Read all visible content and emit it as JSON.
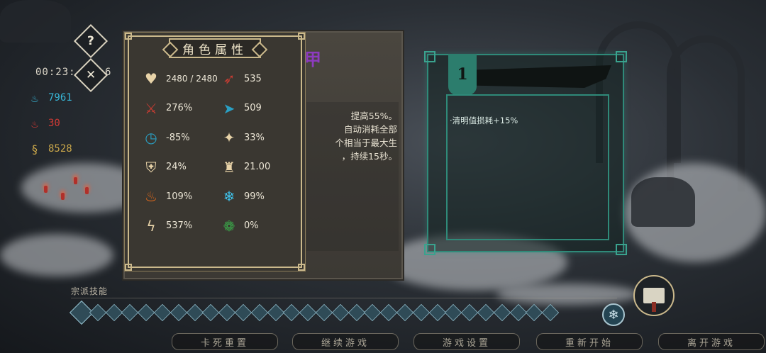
{
  "hud": {
    "help_label": "?",
    "close_label": "✕",
    "timer": "00:23:",
    "timer_tail": "6",
    "resources": [
      {
        "icon": "blue-flame-icon",
        "glyph": "♨",
        "value": "7961",
        "color": "#38b7d8"
      },
      {
        "icon": "red-flame-icon",
        "glyph": "♨",
        "value": "30",
        "color": "#d03a35"
      },
      {
        "icon": "gold-coil-icon",
        "glyph": "§",
        "value": "8528",
        "color": "#c9a64a"
      }
    ]
  },
  "attributes": {
    "title": "角色属性",
    "stats": [
      {
        "icon": "heart-icon",
        "glyph": "♥",
        "color": "#e8d3a8",
        "value": "2480 / 2480"
      },
      {
        "icon": "attack-icon",
        "glyph": "➶",
        "color": "#c83c32",
        "value": "535"
      },
      {
        "icon": "crit-rate-icon",
        "glyph": "⚔",
        "color": "#c83c32",
        "value": "276%"
      },
      {
        "icon": "speed-icon",
        "glyph": "➤",
        "color": "#2aa0c4",
        "value": "509"
      },
      {
        "icon": "cooldown-icon",
        "glyph": "◷",
        "color": "#2aa0c4",
        "value": "-85%"
      },
      {
        "icon": "dodge-icon",
        "glyph": "✦",
        "color": "#e8d3a8",
        "value": "33%"
      },
      {
        "icon": "shield-icon",
        "glyph": "⛨",
        "color": "#e8d3a8",
        "value": "24%"
      },
      {
        "icon": "armor-icon",
        "glyph": "♜",
        "color": "#e8d3a8",
        "value": "21.00"
      },
      {
        "icon": "fire-icon",
        "glyph": "♨",
        "color": "#e76b1a",
        "value": "109%"
      },
      {
        "icon": "frost-icon",
        "glyph": "❄",
        "color": "#3ec0e8",
        "value": "99%"
      },
      {
        "icon": "lightning-icon",
        "glyph": "ϟ",
        "color": "#e8d3a8",
        "value": "537%"
      },
      {
        "icon": "poison-icon",
        "glyph": "❁",
        "color": "#3aa84a",
        "value": "0%"
      }
    ]
  },
  "skill": {
    "title_char": "甲",
    "desc_lines": [
      "提高55%。",
      "自动消耗全部",
      "个相当于最大生",
      "，持续15秒。"
    ]
  },
  "item": {
    "number": "1",
    "effect": "·清明值损耗+15%"
  },
  "bottom": {
    "section_label": "宗派技能",
    "buttons": [
      "卡死重置",
      "继续游戏",
      "游戏设置",
      "重新开始",
      "离开游戏"
    ]
  }
}
